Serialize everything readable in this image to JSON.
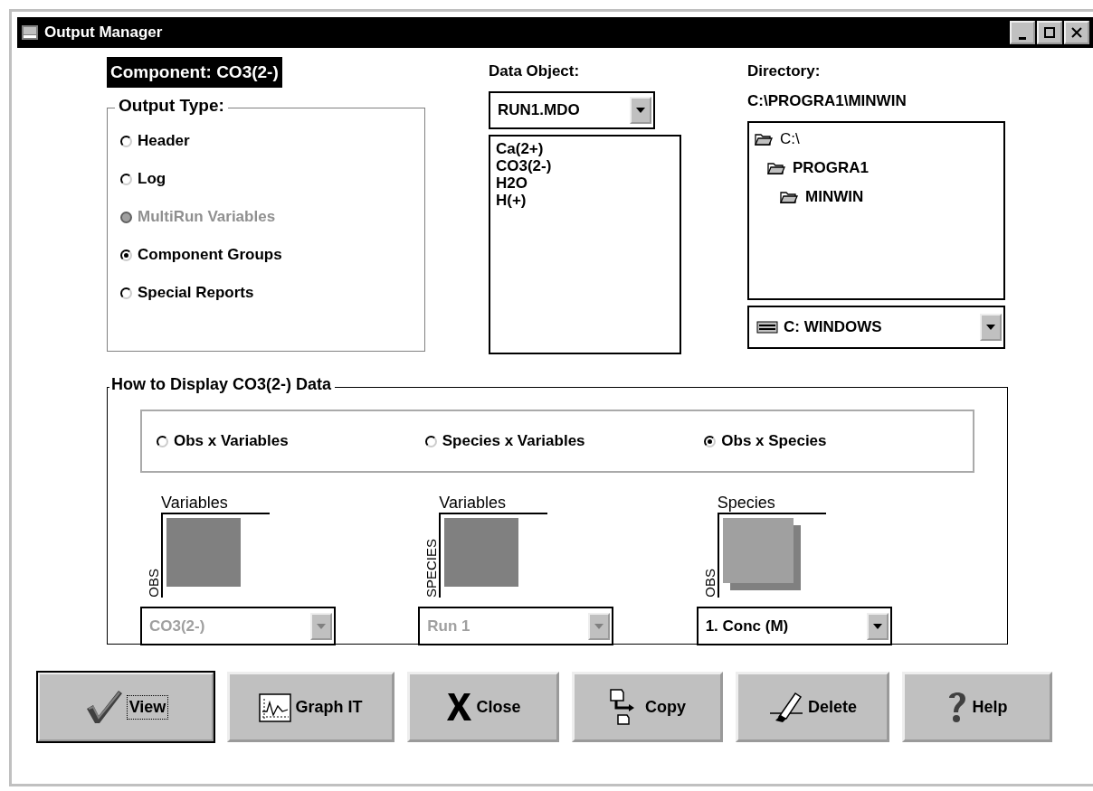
{
  "window": {
    "title": "Output Manager"
  },
  "component_label": "Component: CO3(2-)",
  "output_type": {
    "title": "Output Type:",
    "options": [
      {
        "label": "Header",
        "selected": false,
        "disabled": false
      },
      {
        "label": "Log",
        "selected": false,
        "disabled": false
      },
      {
        "label": "MultiRun Variables",
        "selected": false,
        "disabled": true
      },
      {
        "label": "Component Groups",
        "selected": true,
        "disabled": false
      },
      {
        "label": "Special Reports",
        "selected": false,
        "disabled": false
      }
    ]
  },
  "data_object": {
    "label": "Data Object:",
    "value": "RUN1.MDO",
    "items": [
      "Ca(2+)",
      "CO3(2-)",
      "H2O",
      "H(+)"
    ]
  },
  "directory": {
    "label": "Directory:",
    "path": "C:\\PROGRA1\\MINWIN",
    "tree": [
      {
        "label": "C:\\",
        "children": [
          {
            "label": "PROGRA1",
            "children": [
              {
                "label": "MINWIN"
              }
            ]
          }
        ]
      }
    ],
    "drive": "C: WINDOWS"
  },
  "display": {
    "title": "How to Display CO3(2-) Data",
    "modes": [
      {
        "label": "Obs x Variables",
        "selected": false,
        "top_label": "Variables",
        "side_label": "OBS",
        "dropdown": "CO3(2-)",
        "disabled": true
      },
      {
        "label": "Species x Variables",
        "selected": false,
        "top_label": "Variables",
        "side_label": "SPECIES",
        "dropdown": "Run 1",
        "disabled": true
      },
      {
        "label": "Obs x Species",
        "selected": true,
        "top_label": "Species",
        "side_label": "OBS",
        "dropdown": "1. Conc (M)",
        "disabled": false
      }
    ]
  },
  "buttons": [
    {
      "label": "View",
      "kind": "view",
      "default": true
    },
    {
      "label": "Graph IT",
      "kind": "graph",
      "default": false
    },
    {
      "label": "Close",
      "kind": "close",
      "default": false
    },
    {
      "label": "Copy",
      "kind": "copy",
      "default": false
    },
    {
      "label": "Delete",
      "kind": "delete",
      "default": false
    },
    {
      "label": "Help",
      "kind": "help",
      "default": false
    }
  ]
}
